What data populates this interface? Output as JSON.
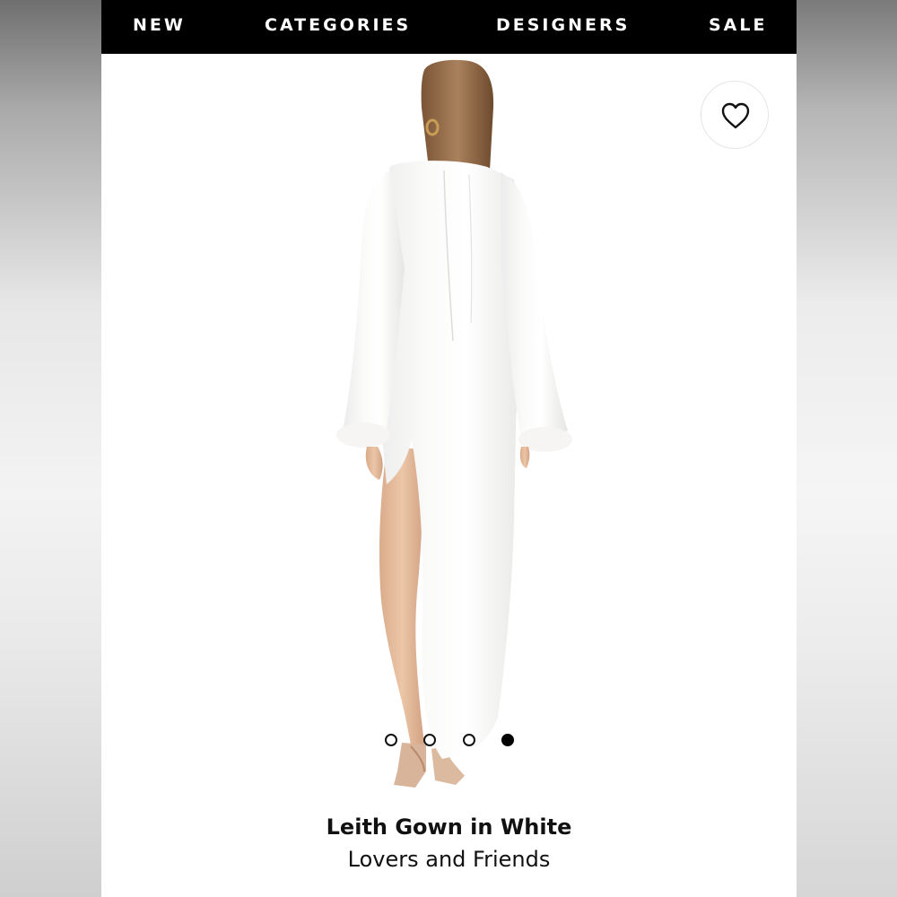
{
  "nav": {
    "items": [
      {
        "label": "NEW"
      },
      {
        "label": "CATEGORIES"
      },
      {
        "label": "DESIGNERS"
      },
      {
        "label": "SALE"
      }
    ]
  },
  "product": {
    "name": "Leith Gown in White",
    "brand": "Lovers and Friends",
    "image_description": "model-back-view",
    "favorite_icon": "heart-outline-icon"
  },
  "carousel": {
    "total": 4,
    "active_index": 3
  },
  "colors": {
    "nav_bg": "#000000",
    "nav_text": "#ffffff",
    "text": "#111111",
    "dot_active": "#000000"
  }
}
